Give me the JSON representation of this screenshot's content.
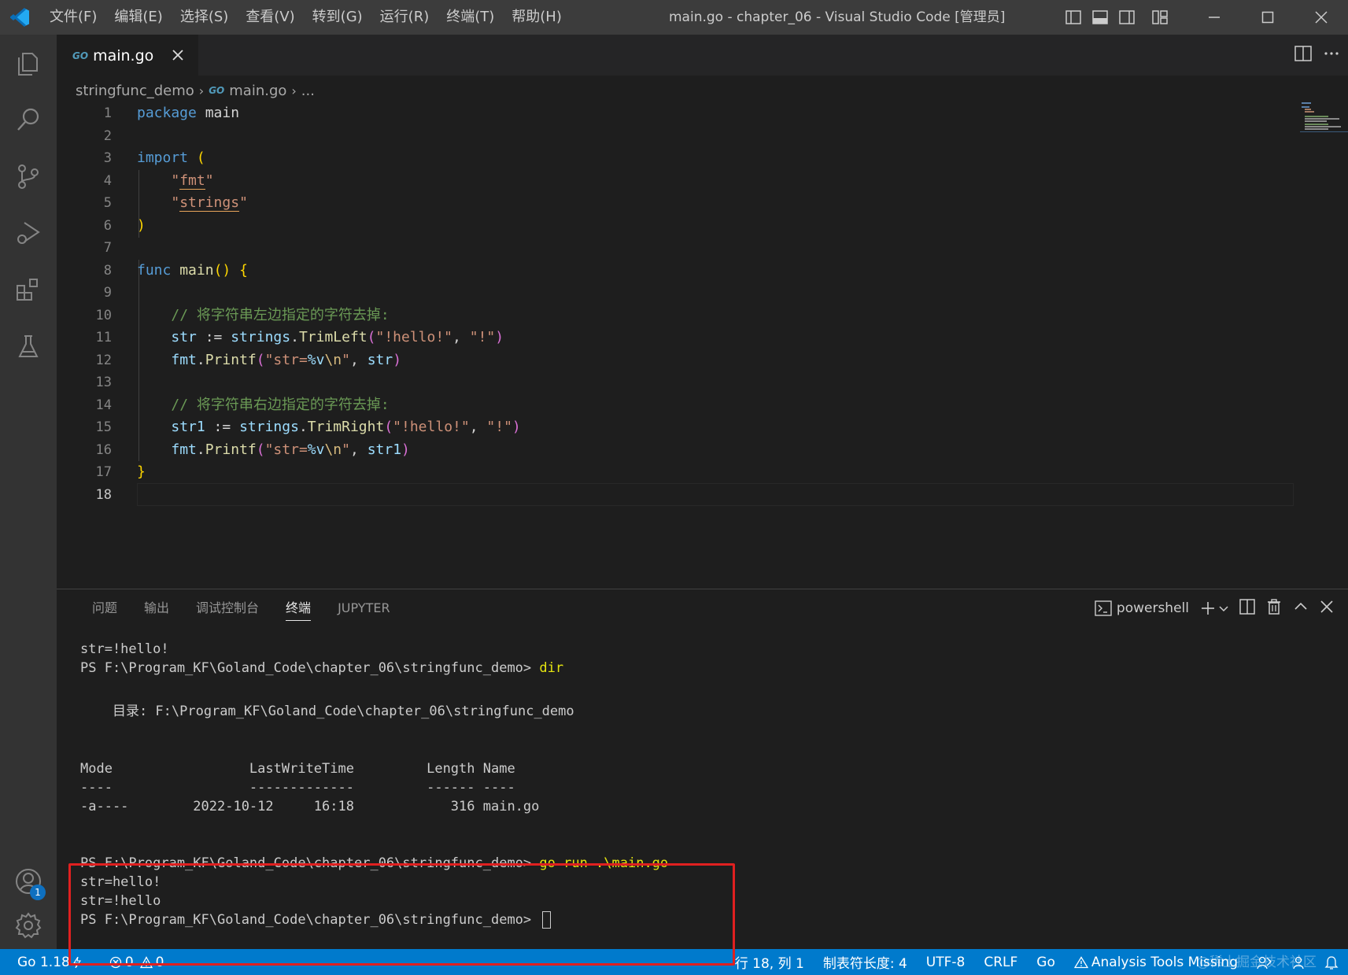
{
  "titlebar": {
    "menu": [
      "文件(F)",
      "编辑(E)",
      "选择(S)",
      "查看(V)",
      "转到(G)",
      "运行(R)",
      "终端(T)",
      "帮助(H)"
    ],
    "title": "main.go - chapter_06 - Visual Studio Code [管理员]"
  },
  "tab": {
    "label": "main.go",
    "icon": "GO"
  },
  "breadcrumb": {
    "folder": "stringfunc_demo",
    "file": "main.go",
    "more": "..."
  },
  "editor": {
    "line_numbers": [
      "1",
      "2",
      "3",
      "4",
      "5",
      "6",
      "7",
      "8",
      "9",
      "10",
      "11",
      "12",
      "13",
      "14",
      "15",
      "16",
      "17",
      "18"
    ],
    "active_line": 18,
    "code": {
      "l1": [
        "package",
        " main"
      ],
      "l3": [
        "import",
        " ",
        "("
      ],
      "l4": [
        "\"",
        "fmt",
        "\""
      ],
      "l5": [
        "\"",
        "strings",
        "\""
      ],
      "l6": [
        ")"
      ],
      "l8": [
        "func",
        " ",
        "main",
        "()",
        " ",
        "{"
      ],
      "l10": "// 将字符串左边指定的字符去掉:",
      "l11": [
        "str",
        " := ",
        "strings",
        ".",
        "TrimLeft",
        "(",
        "\"!hello!\"",
        ", ",
        "\"!\"",
        ")"
      ],
      "l12": [
        "fmt",
        ".",
        "Printf",
        "(",
        "\"str=",
        "%v",
        "\\n",
        "\"",
        ", ",
        "str",
        ")"
      ],
      "l14": "// 将字符串右边指定的字符去掉:",
      "l15": [
        "str1",
        " := ",
        "strings",
        ".",
        "TrimRight",
        "(",
        "\"!hello!\"",
        ", ",
        "\"!\"",
        ")"
      ],
      "l16": [
        "fmt",
        ".",
        "Printf",
        "(",
        "\"str=",
        "%v",
        "\\n",
        "\"",
        ", ",
        "str1",
        ")"
      ],
      "l17": [
        "}"
      ]
    }
  },
  "panel": {
    "tabs": [
      "问题",
      "输出",
      "调试控制台",
      "终端",
      "JUPYTER"
    ],
    "active_tab": "终端",
    "shell": "powershell"
  },
  "terminal": {
    "l1": "str=!hello!",
    "l2_prompt": "PS F:\\Program_KF\\Goland_Code\\chapter_06\\stringfunc_demo> ",
    "l2_cmd": "dir",
    "l3": "    目录: F:\\Program_KF\\Goland_Code\\chapter_06\\stringfunc_demo",
    "l4": "Mode                 LastWriteTime         Length Name",
    "l5": "----                 -------------         ------ ----",
    "l6": "-a----        2022-10-12     16:18            316 main.go",
    "l7_prompt": "PS F:\\Program_KF\\Goland_Code\\chapter_06\\stringfunc_demo> ",
    "l7_cmd": "go run .\\main.go",
    "l8": "str=hello!",
    "l9": "str=!hello",
    "l10_prompt": "PS F:\\Program_KF\\Goland_Code\\chapter_06\\stringfunc_demo> "
  },
  "statusbar": {
    "go_version": "Go 1.18",
    "errors": "0",
    "warnings": "0",
    "position": "行 18, 列 1",
    "tab_size": "制表符长度: 4",
    "encoding": "UTF-8",
    "eol": "CRLF",
    "language": "Go",
    "analysis": "Analysis Tools Missing",
    "watermark": "@稀土掘金技术社区"
  },
  "accounts_badge": "1",
  "colors": {
    "statusbar": "#007acc",
    "highlight": "#e02020",
    "titlebar": "#3c3c3c"
  }
}
